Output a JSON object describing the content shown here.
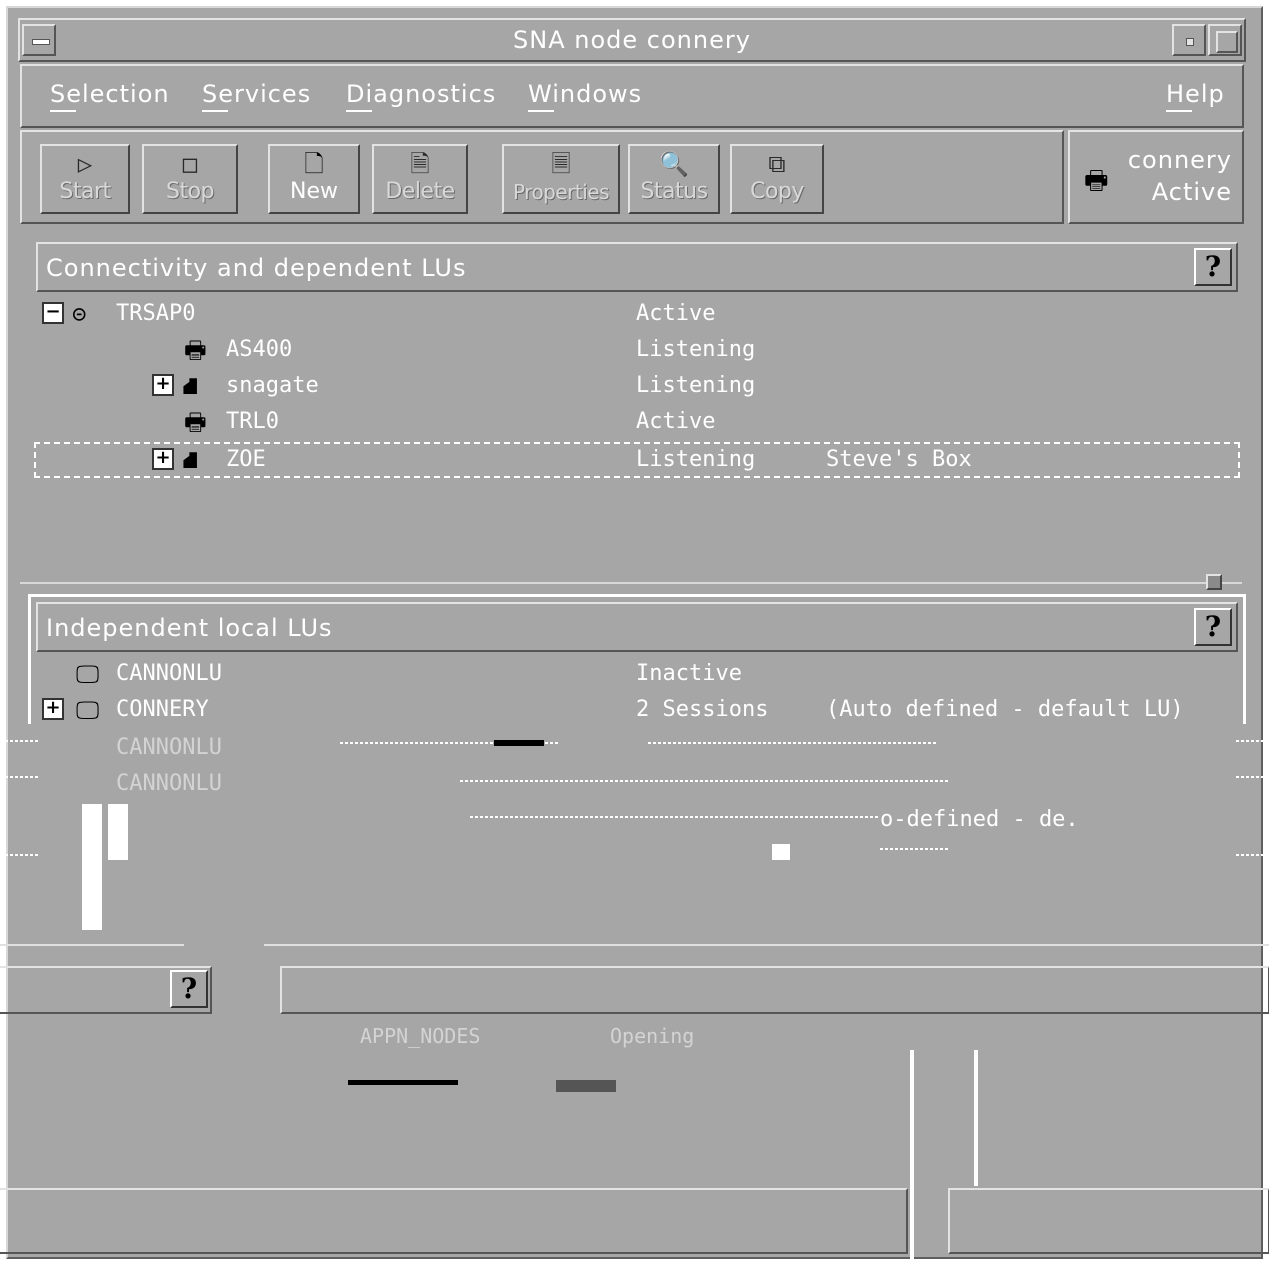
{
  "window": {
    "title": "SNA node connery",
    "sysmenu_icon": "dash-icon",
    "minimize_icon": "minimize-icon",
    "maximize_icon": "maximize-icon"
  },
  "menubar": {
    "items": [
      "Selection",
      "Services",
      "Diagnostics",
      "Windows"
    ],
    "help": "Help"
  },
  "toolbar": {
    "buttons": [
      {
        "label": "Start",
        "icon": "play-icon",
        "enabled": false
      },
      {
        "label": "Stop",
        "icon": "stop-icon",
        "enabled": false
      },
      {
        "label": "New",
        "icon": "new-document-icon",
        "enabled": true
      },
      {
        "label": "Delete",
        "icon": "delete-document-icon",
        "enabled": false
      },
      {
        "label": "Properties",
        "icon": "properties-icon",
        "enabled": false
      },
      {
        "label": "Status",
        "icon": "status-icon",
        "enabled": false
      },
      {
        "label": "Copy",
        "icon": "copy-icon",
        "enabled": false
      }
    ]
  },
  "node": {
    "name": "connery",
    "status": "Active",
    "icon": "computer-node-icon"
  },
  "connectivity": {
    "title": "Connectivity and dependent LUs",
    "help_icon": "help-question-icon",
    "rows": [
      {
        "name": "TRSAP0",
        "status": "Active",
        "description": "",
        "icon": "port-icon",
        "expander": "−"
      },
      {
        "name": "AS400",
        "status": "Listening",
        "description": "",
        "icon": "host-link-icon",
        "expander": ""
      },
      {
        "name": "snagate",
        "status": "Listening",
        "description": "",
        "icon": "gateway-icon",
        "expander": "+"
      },
      {
        "name": "TRL0",
        "status": "Active",
        "description": "",
        "icon": "host-link-icon",
        "expander": ""
      },
      {
        "name": "ZOE",
        "status": "Listening",
        "description": "Steve's Box",
        "icon": "gateway-icon",
        "expander": "+"
      }
    ]
  },
  "independent": {
    "title": "Independent local LUs",
    "help_icon": "help-question-icon",
    "rows": [
      {
        "name": "CANNONLU",
        "status": "Inactive",
        "description": "",
        "icon": "terminal-icon",
        "expander": ""
      },
      {
        "name": "CONNERY",
        "status": "2 Sessions",
        "description": "(Auto defined - default LU)",
        "icon": "terminal-icon",
        "expander": "+"
      }
    ]
  },
  "glitch": {
    "row1": "CANNONLU",
    "row2": "CANNONLU",
    "fragment1": "o-defined - de.",
    "fragment2": "APPN_NODES",
    "fragment3": "Opening",
    "help_icon": "help-question-icon"
  }
}
